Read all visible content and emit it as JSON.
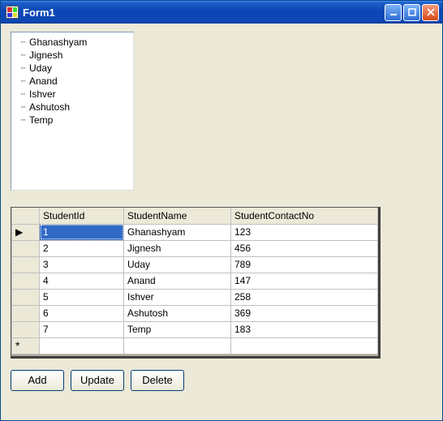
{
  "window": {
    "title": "Form1"
  },
  "tree": {
    "items": [
      "Ghanashyam",
      "Jignesh",
      "Uday",
      "Anand",
      "Ishver",
      "Ashutosh",
      "Temp"
    ]
  },
  "grid": {
    "columns": [
      "StudentId",
      "StudentName",
      "StudentContactNo"
    ],
    "rows": [
      {
        "id": "1",
        "name": "Ghanashyam",
        "contact": "123"
      },
      {
        "id": "2",
        "name": "Jignesh",
        "contact": "456"
      },
      {
        "id": "3",
        "name": "Uday",
        "contact": "789"
      },
      {
        "id": "4",
        "name": "Anand",
        "contact": "147"
      },
      {
        "id": "5",
        "name": "Ishver",
        "contact": "258"
      },
      {
        "id": "6",
        "name": "Ashutosh",
        "contact": "369"
      },
      {
        "id": "7",
        "name": "Temp",
        "contact": "183"
      }
    ],
    "row_indicator": "▶",
    "newrow_indicator": "*"
  },
  "buttons": {
    "add": "Add",
    "update": "Update",
    "delete": "Delete"
  }
}
